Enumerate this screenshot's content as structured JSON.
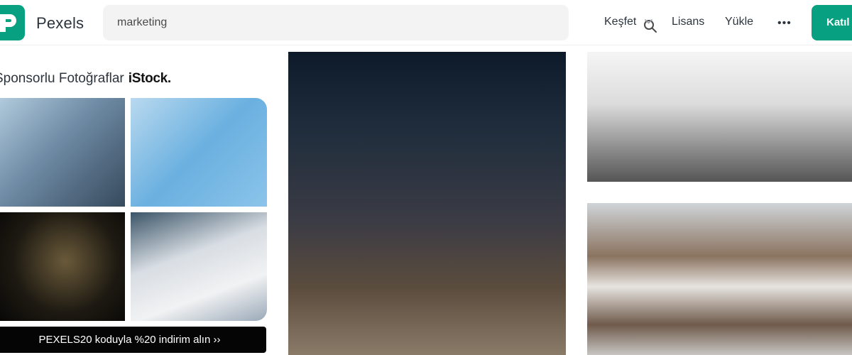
{
  "brand": {
    "name": "Pexels",
    "color": "#07a081"
  },
  "search": {
    "value": "marketing",
    "icon": "search-icon"
  },
  "nav": {
    "explore": "Keşfet",
    "license": "Lisans",
    "upload": "Yükle",
    "more": "•••",
    "join": "Katıl"
  },
  "sponsored": {
    "title": "Sponsorlu Fotoğraflar",
    "provider": "iStock.",
    "promo": "PEXELS20 koduyla %20 indirim alın ››"
  }
}
